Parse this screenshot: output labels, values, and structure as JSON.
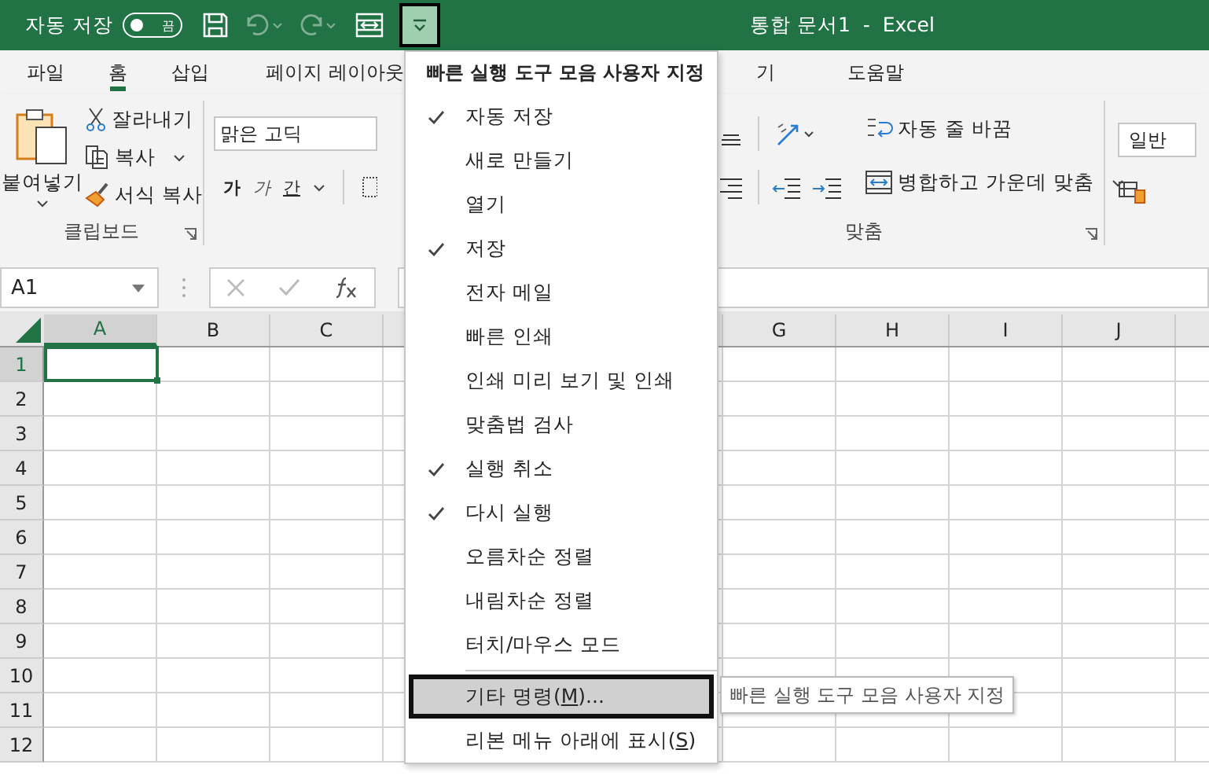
{
  "title_bar": {
    "autosave_label": "자동 저장",
    "autosave_toggle": {
      "on": false,
      "label": "끔"
    },
    "customize_button": {
      "selected": true
    },
    "title": "통합 문서1  -  Excel"
  },
  "ribbon_tabs": [
    {
      "label": "파일",
      "selected": false
    },
    {
      "label": "홈",
      "selected": true
    },
    {
      "label": "삽입",
      "selected": false
    },
    {
      "label": "페이지 레이아웃",
      "selected": false
    },
    {
      "label": "기",
      "selected": false
    },
    {
      "label": "도움말",
      "selected": false
    }
  ],
  "clipboard": {
    "paste": "붙여넣기",
    "cut": "잘라내기",
    "copy": "복사",
    "format_painter": "서식 복사",
    "group_label": "클립보드"
  },
  "font": {
    "font_name": "맑은 고딕",
    "bold": "가",
    "italic": "가",
    "underline": "간"
  },
  "alignment": {
    "wrap_text": "자동 줄 바꿈",
    "merge": "병합하고 가운데 맞춤",
    "group_label": "맞춤"
  },
  "number": {
    "format": "일반"
  },
  "formula_bar": {
    "name_box": "A1"
  },
  "sheet": {
    "columns_left": [
      "A",
      "B",
      "C"
    ],
    "columns_right": [
      "G",
      "H",
      "I",
      "J"
    ],
    "rows": [
      "1",
      "2",
      "3",
      "4",
      "5",
      "6",
      "7",
      "8",
      "9",
      "10",
      "11",
      "12"
    ]
  },
  "menu": {
    "title": "빠른 실행 도구 모음 사용자 지정",
    "items": [
      {
        "label": "자동 저장",
        "checked": true
      },
      {
        "label": "새로 만들기",
        "checked": false
      },
      {
        "label": "열기",
        "checked": false
      },
      {
        "label": "저장",
        "checked": true
      },
      {
        "label": "전자 메일",
        "checked": false
      },
      {
        "label": "빠른 인쇄",
        "checked": false
      },
      {
        "label": "인쇄 미리 보기 및 인쇄",
        "checked": false
      },
      {
        "label": "맞춤법 검사",
        "checked": false
      },
      {
        "label": "실행 취소",
        "checked": true
      },
      {
        "label": "다시 실행",
        "checked": true
      },
      {
        "label": "오름차순 정렬",
        "checked": false
      },
      {
        "label": "내림차순 정렬",
        "checked": false
      },
      {
        "label": "터치/마우스 모드",
        "checked": false
      }
    ],
    "commands": [
      {
        "before": "기타 명령(",
        "key": "M",
        "after": ")...",
        "selected": true
      },
      {
        "before": "리본 메뉴 아래에 표시(",
        "key": "S",
        "after": ")",
        "selected": false
      }
    ]
  },
  "tooltip": {
    "text": "빠른 실행 도구 모음 사용자 지정"
  }
}
